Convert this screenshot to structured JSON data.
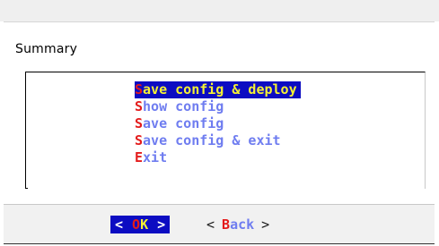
{
  "dialog": {
    "title": "Summary"
  },
  "menu": {
    "items": [
      {
        "hot": "S",
        "rest": "ave config & deploy",
        "selected": true
      },
      {
        "hot": "S",
        "rest": "how config",
        "selected": false
      },
      {
        "hot": "S",
        "rest": "ave config",
        "selected": false
      },
      {
        "hot": "S",
        "rest": "ave config & exit",
        "selected": false
      },
      {
        "hot": "E",
        "rest": "xit",
        "selected": false
      }
    ]
  },
  "buttons": {
    "ok": {
      "left_bracket": "<",
      "hot": "O",
      "rest": "K",
      "right_bracket": ">"
    },
    "back": {
      "left_bracket": "<",
      "hot": "B",
      "rest": "ack",
      "right_bracket": ">"
    }
  },
  "colors": {
    "selection_bg": "#0c0cc2",
    "selection_fg": "#f6f233",
    "hotkey": "#e41b1b",
    "item_fg": "#6f7df0"
  }
}
